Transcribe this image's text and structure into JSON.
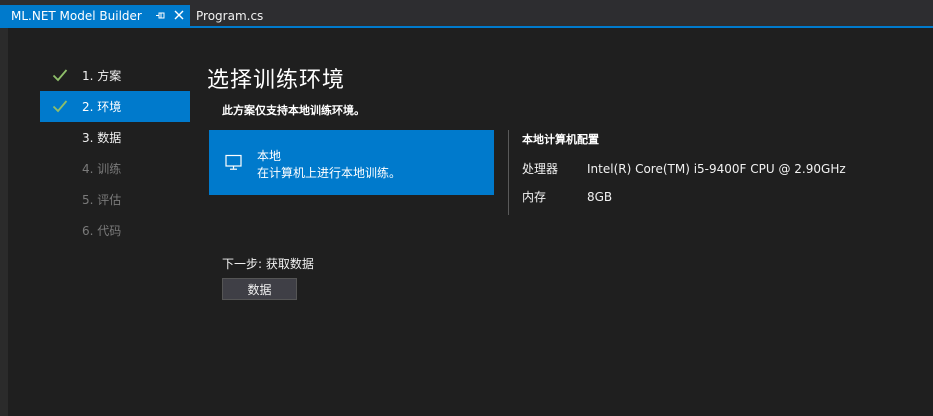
{
  "tabs": {
    "active_label": "ML.NET Model Builder",
    "inactive_label": "Program.cs"
  },
  "colors": {
    "accent": "#007acc",
    "background": "#1f1f1f",
    "check": "#8fbf6a"
  },
  "steps": [
    {
      "label": "1. 方案",
      "state": "done"
    },
    {
      "label": "2. 环境",
      "state": "active"
    },
    {
      "label": "3. 数据",
      "state": "upcoming"
    },
    {
      "label": "4. 训练",
      "state": "disabled"
    },
    {
      "label": "5. 评估",
      "state": "disabled"
    },
    {
      "label": "6. 代码",
      "state": "disabled"
    }
  ],
  "main": {
    "title": "选择训练环境",
    "subtitle": "此方案仅支持本地训练环境。",
    "env_card": {
      "name": "本地",
      "description": "在计算机上进行本地训练。",
      "icon": "monitor-icon"
    },
    "config": {
      "title": "本地计算机配置",
      "cpu_key": "处理器",
      "cpu_value": "Intel(R) Core(TM) i5-9400F CPU @ 2.90GHz",
      "mem_key": "内存",
      "mem_value": "8GB"
    },
    "next": {
      "label": "下一步: 获取数据",
      "button": "数据"
    }
  }
}
